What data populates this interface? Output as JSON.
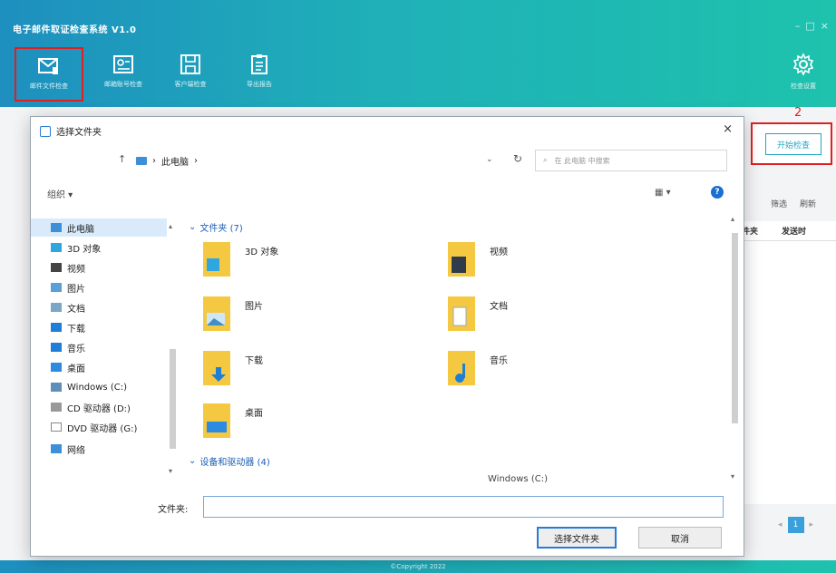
{
  "app": {
    "title": "电子邮件取证检查系统 V1.0",
    "window_controls": [
      "–",
      "□",
      "×"
    ],
    "toolbar": [
      {
        "label": "邮件文件检查",
        "icon": "mail-icon",
        "selected": true
      },
      {
        "label": "邮箱账号检查",
        "icon": "account-card-icon",
        "selected": false
      },
      {
        "label": "客户端检查",
        "icon": "save-disk-icon",
        "selected": false
      },
      {
        "label": "导出报告",
        "icon": "report-icon",
        "selected": false
      }
    ],
    "settings_label": "检查设置",
    "step_marker": "2",
    "start_button": "开始检查",
    "actions": [
      "筛选",
      "刷新"
    ],
    "table_headers": [
      "件夹",
      "发送时"
    ],
    "pager_current": "1",
    "footer": "©Copyright 2022",
    "accent_color": "#1fb0b8",
    "highlight_color": "#e02020"
  },
  "dialog": {
    "title": "选择文件夹",
    "close": "×",
    "nav_up": "↑",
    "breadcrumb": [
      "此电脑",
      "›"
    ],
    "breadcrumb_prefix": "›",
    "address_dropdown": "⌄",
    "refresh": "↻",
    "search_placeholder": "在 此电脑 中搜索",
    "organize": "组织 ▾",
    "view_toggle": "▦ ▾",
    "help": "?",
    "nav_items": [
      {
        "label": "此电脑",
        "icon": "computer-icon",
        "color": "#3d8fd8"
      },
      {
        "label": "3D 对象",
        "icon": "cube-3d-icon",
        "color": "#2ea7e0"
      },
      {
        "label": "视频",
        "icon": "video-icon",
        "color": "#444444"
      },
      {
        "label": "图片",
        "icon": "picture-icon",
        "color": "#5aa0d8"
      },
      {
        "label": "文档",
        "icon": "document-icon",
        "color": "#7aa7c8"
      },
      {
        "label": "下载",
        "icon": "download-icon",
        "color": "#1f7fd6"
      },
      {
        "label": "音乐",
        "icon": "music-icon",
        "color": "#1f7fd6"
      },
      {
        "label": "桌面",
        "icon": "desktop-icon",
        "color": "#2c8be0"
      },
      {
        "label": "Windows (C:)",
        "icon": "drive-icon",
        "color": "#5f8fb8"
      },
      {
        "label": "CD 驱动器 (D:)",
        "icon": "cd-drive-icon",
        "color": "#999999"
      },
      {
        "label": "DVD 驱动器 (G:)",
        "icon": "dvd-drive-icon",
        "color": "#888888"
      },
      {
        "label": "网络",
        "icon": "network-icon",
        "color": "#3d8fd8"
      }
    ],
    "group_folders": "文件夹 (7)",
    "group_devices": "设备和驱动器 (4)",
    "folders": [
      {
        "name": "3D 对象",
        "icon": "cube-3d-icon"
      },
      {
        "name": "视频",
        "icon": "video-icon"
      },
      {
        "name": "图片",
        "icon": "picture-icon"
      },
      {
        "name": "文档",
        "icon": "document-icon"
      },
      {
        "name": "下载",
        "icon": "download-icon"
      },
      {
        "name": "音乐",
        "icon": "music-icon"
      },
      {
        "name": "桌面",
        "icon": "desktop-icon"
      }
    ],
    "partial_device": "Windows (C:)",
    "folder_label": "文件夹:",
    "folder_value": "",
    "select_button": "选择文件夹",
    "cancel_button": "取消"
  }
}
